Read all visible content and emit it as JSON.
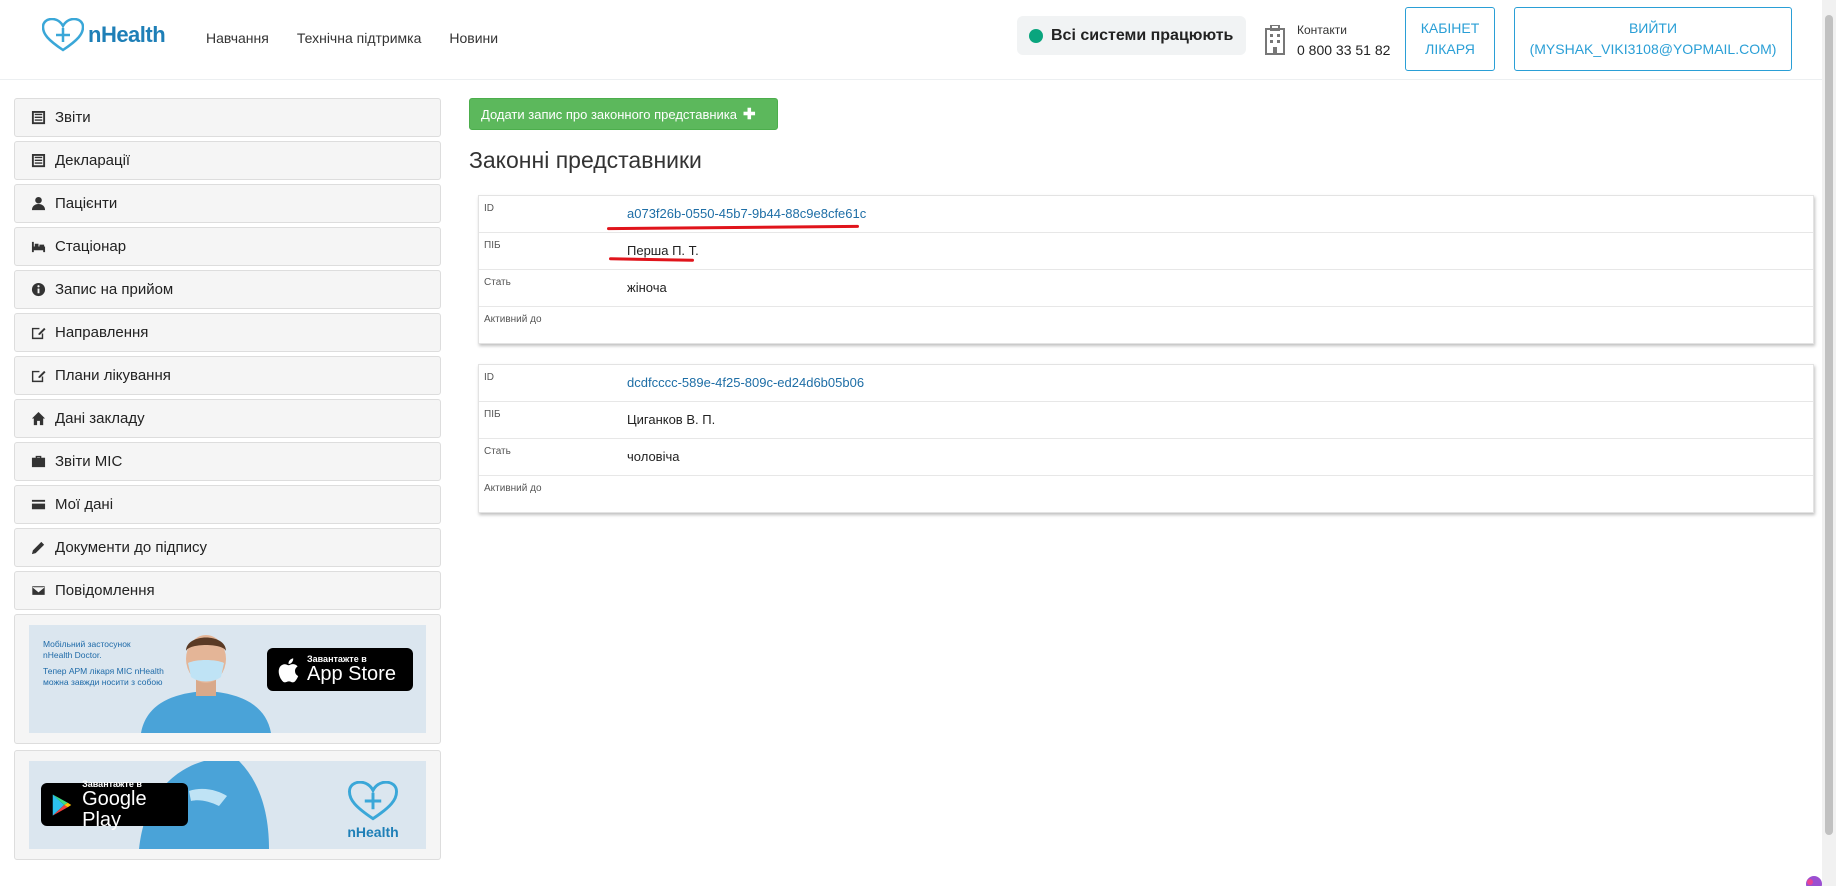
{
  "header": {
    "logo_text": "nHealth",
    "nav": [
      "Навчання",
      "Технічна підтримка",
      "Новини"
    ],
    "status_text": "Всі системи працюють",
    "contacts_label": "Контакти",
    "contacts_phone": "0 800 33 51 82",
    "cabinet_line1": "КАБІНЕТ",
    "cabinet_line2": "ЛІКАРЯ",
    "logout_line1": "ВИЙТИ",
    "logout_line2": "(MYSHAK_VIKI3108@YOPMAIL.COM)"
  },
  "sidebar": {
    "items": [
      {
        "label": "Звіти",
        "icon": "list-icon"
      },
      {
        "label": "Декларації",
        "icon": "list-icon"
      },
      {
        "label": "Пацієнти",
        "icon": "user-icon"
      },
      {
        "label": "Стаціонар",
        "icon": "bed-icon"
      },
      {
        "label": "Запис на прийом",
        "icon": "info-icon"
      },
      {
        "label": "Направлення",
        "icon": "edit-icon"
      },
      {
        "label": "Плани лікування",
        "icon": "edit-icon"
      },
      {
        "label": "Дані закладу",
        "icon": "home-icon"
      },
      {
        "label": "Звіти МІС",
        "icon": "briefcase-icon"
      },
      {
        "label": "Мої дані",
        "icon": "card-icon"
      },
      {
        "label": "Документи до підпису",
        "icon": "pencil-icon"
      },
      {
        "label": "Повідомлення",
        "icon": "envelope-icon"
      }
    ],
    "promo_appstore": {
      "text_line1": "Мобільний застосунок",
      "text_line2": "nHealth Doctor.",
      "text_line3": "Тепер АРМ лікаря МІС nHealth",
      "text_line4": "можна завжди носити з собою",
      "store_small": "Завантажте в",
      "store_big": "App Store"
    },
    "promo_googleplay": {
      "store_small": "Завантажте в",
      "store_big": "Google Play",
      "logo_text": "nHealth"
    }
  },
  "main": {
    "add_button_label": "Додати запис про законного представника",
    "title": "Законні представники",
    "labels": {
      "id": "ID",
      "name": "ПІБ",
      "sex": "Стать",
      "active_until": "Активний до"
    },
    "representatives": [
      {
        "id": "a073f26b-0550-45b7-9b44-88c9e8cfe61c",
        "name": "Перша П. Т.",
        "sex": "жіноча",
        "active_until": ""
      },
      {
        "id": "dcdfcccc-589e-4f25-809c-ed24d6b05b06",
        "name": "Циганков В. П.",
        "sex": "чоловіча",
        "active_until": ""
      }
    ]
  },
  "colors": {
    "accent": "#2a9fd6",
    "success": "#5cb85c",
    "status_ok": "#0aa57e",
    "annotation": "#e0141b"
  }
}
